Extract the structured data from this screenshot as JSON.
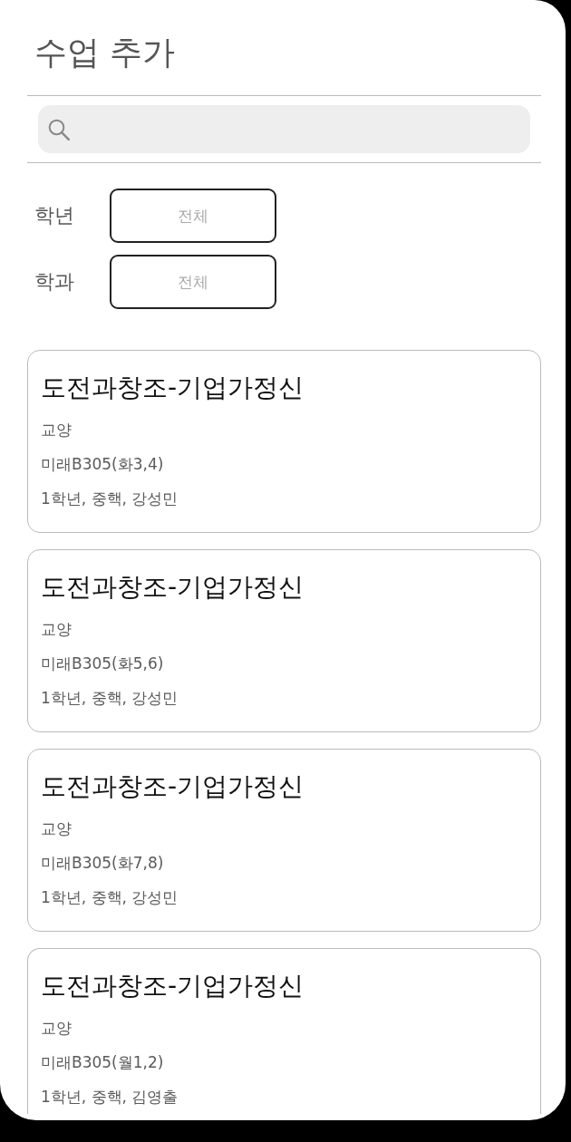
{
  "screen": {
    "title": "수업 추가"
  },
  "filters": [
    {
      "label": "학년",
      "placeholder": "전체"
    },
    {
      "label": "학과",
      "placeholder": "전체"
    }
  ],
  "courses": [
    {
      "title": "도전과창조-기업가정신",
      "category": "교양",
      "location": "미래B305(화3,4)",
      "info": "1학년, 중핵, 강성민"
    },
    {
      "title": "도전과창조-기업가정신",
      "category": "교양",
      "location": "미래B305(화5,6)",
      "info": "1학년, 중핵, 강성민"
    },
    {
      "title": "도전과창조-기업가정신",
      "category": "교양",
      "location": "미래B305(화7,8)",
      "info": "1학년, 중핵, 강성민"
    },
    {
      "title": "도전과창조-기업가정신",
      "category": "교양",
      "location": "미래B305(월1,2)",
      "info": "1학년, 중핵, 김영출"
    }
  ]
}
